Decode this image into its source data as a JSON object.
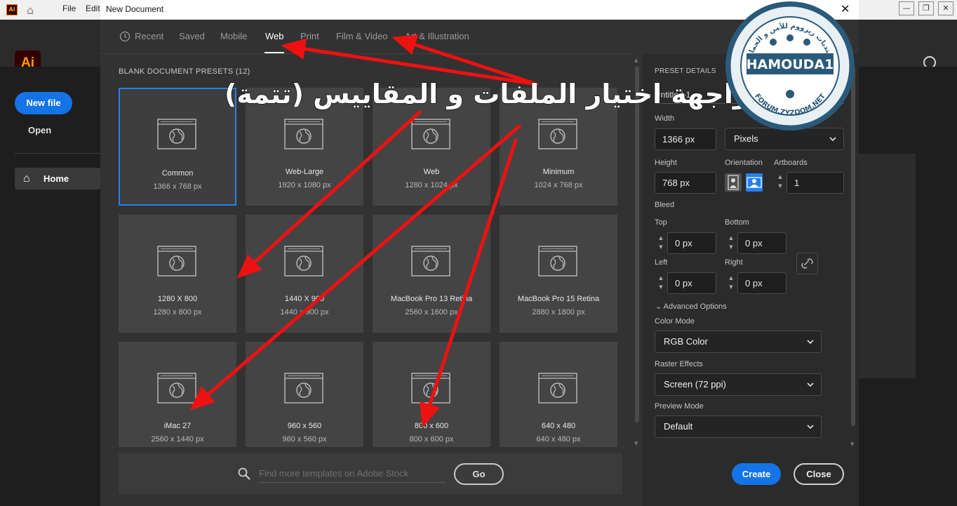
{
  "app": {
    "menu": [
      "File",
      "Edit"
    ],
    "logo": "Ai",
    "new_file": "New file",
    "open": "Open",
    "home": "Home"
  },
  "dialog": {
    "title": "New Document",
    "tabs": [
      "Recent",
      "Saved",
      "Mobile",
      "Web",
      "Print",
      "Film & Video",
      "Art & Illustration"
    ],
    "active_tab": "Web",
    "section_title": "BLANK DOCUMENT PRESETS",
    "preset_count": "(12)",
    "presets": [
      {
        "name": "Common",
        "size": "1366 x 768 px"
      },
      {
        "name": "Web-Large",
        "size": "1920 x 1080 px"
      },
      {
        "name": "Web",
        "size": "1280 x 1024 px"
      },
      {
        "name": "Minimum",
        "size": "1024 x 768 px"
      },
      {
        "name": "1280 X 800",
        "size": "1280 x 800 px"
      },
      {
        "name": "1440 X 900",
        "size": "1440 x 900 px"
      },
      {
        "name": "MacBook Pro 13 Retina",
        "size": "2560 x 1600 px"
      },
      {
        "name": "MacBook Pro 15 Retina",
        "size": "2880 x 1800 px"
      },
      {
        "name": "iMac 27",
        "size": "2560 x 1440 px"
      },
      {
        "name": "960 x 560",
        "size": "960 x 560 px"
      },
      {
        "name": "800 x 600",
        "size": "800 x 600 px"
      },
      {
        "name": "640 x 480",
        "size": "640 x 480 px"
      }
    ],
    "selected_preset": "Common",
    "search_placeholder": "Find more templates on Adobe Stock",
    "go": "Go"
  },
  "details": {
    "header": "PRESET DETAILS",
    "name_value": "Untitled-1",
    "width_label": "Width",
    "width_value": "1366 px",
    "units": "Pixels",
    "height_label": "Height",
    "height_value": "768 px",
    "orientation_label": "Orientation",
    "artboards_label": "Artboards",
    "artboards_value": "1",
    "bleed_label": "Bleed",
    "top_label": "Top",
    "top_value": "0 px",
    "bottom_label": "Bottom",
    "bottom_value": "0 px",
    "left_label": "Left",
    "left_value": "0 px",
    "right_label": "Right",
    "right_value": "0 px",
    "advanced": "Advanced Options",
    "color_mode_label": "Color Mode",
    "color_mode": "RGB Color",
    "raster_label": "Raster Effects",
    "raster": "Screen (72 ppi)",
    "preview_label": "Preview Mode",
    "preview": "Default",
    "create": "Create",
    "close": "Close"
  },
  "overlay": {
    "caption": "واجهة اختيار الملفات و المقاييس (تتمة)",
    "seal_name": "HAMOUDA1",
    "seal_url": "FORUM.ZYZOOM.NET",
    "seal_arabic": "منتديات زيزووم للأمن و الحماية",
    "arrow_color": "#ee1111"
  },
  "colors": {
    "accent": "#1473e6",
    "selected_border": "#2680eb"
  }
}
